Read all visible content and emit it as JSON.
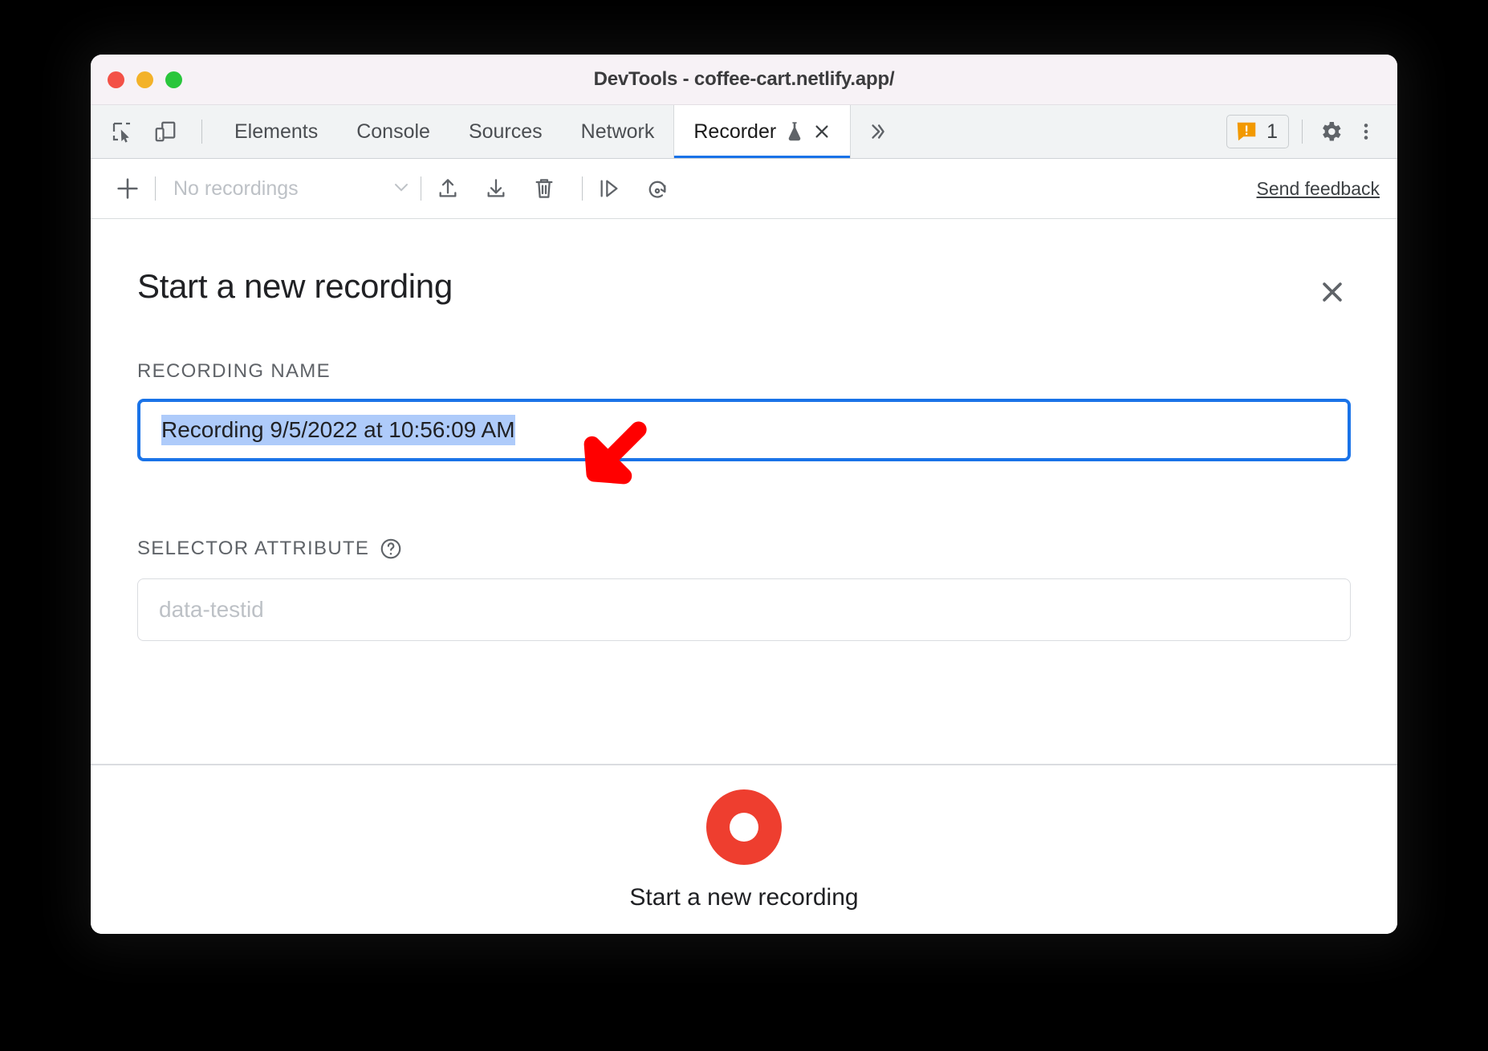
{
  "window": {
    "title": "DevTools - coffee-cart.netlify.app/",
    "traffic_lights": [
      "close",
      "minimize",
      "zoom"
    ]
  },
  "devtools_tabbar": {
    "left_icons": [
      {
        "name": "inspect-element-icon"
      },
      {
        "name": "device-toolbar-icon"
      }
    ],
    "tabs": [
      {
        "label": "Elements",
        "active": false
      },
      {
        "label": "Console",
        "active": false
      },
      {
        "label": "Sources",
        "active": false
      },
      {
        "label": "Network",
        "active": false
      },
      {
        "label": "Recorder",
        "active": true,
        "experimental": true,
        "closable": true
      }
    ],
    "more_tabs_label": "»",
    "warnings": {
      "count": "1",
      "color": "#f29900"
    },
    "settings_icon": "gear-icon",
    "menu_icon": "more-vertical-icon"
  },
  "recorder_toolbar": {
    "add_label": "+",
    "recordings_select_value": "No recordings",
    "icons": [
      {
        "name": "import-icon"
      },
      {
        "name": "export-icon"
      },
      {
        "name": "delete-icon"
      },
      {
        "name": "step-over-icon"
      },
      {
        "name": "replay-icon"
      }
    ],
    "feedback_link": "Send feedback"
  },
  "panel": {
    "title": "Start a new recording",
    "close_label": "✕",
    "fields": [
      {
        "label": "RECORDING NAME",
        "value": "Recording 9/5/2022 at 10:56:09 AM",
        "focused": true,
        "has_help": false
      },
      {
        "label": "SELECTOR ATTRIBUTE",
        "placeholder": "data-testid",
        "focused": false,
        "has_help": true
      }
    ],
    "footer": {
      "button_name": "record-button",
      "button_color": "#ee3e2f",
      "label": "Start a new recording"
    }
  },
  "annotation": {
    "arrow_color": "#ff0000",
    "arrow_direction": "down-left",
    "points_at": "recording-name-input"
  }
}
